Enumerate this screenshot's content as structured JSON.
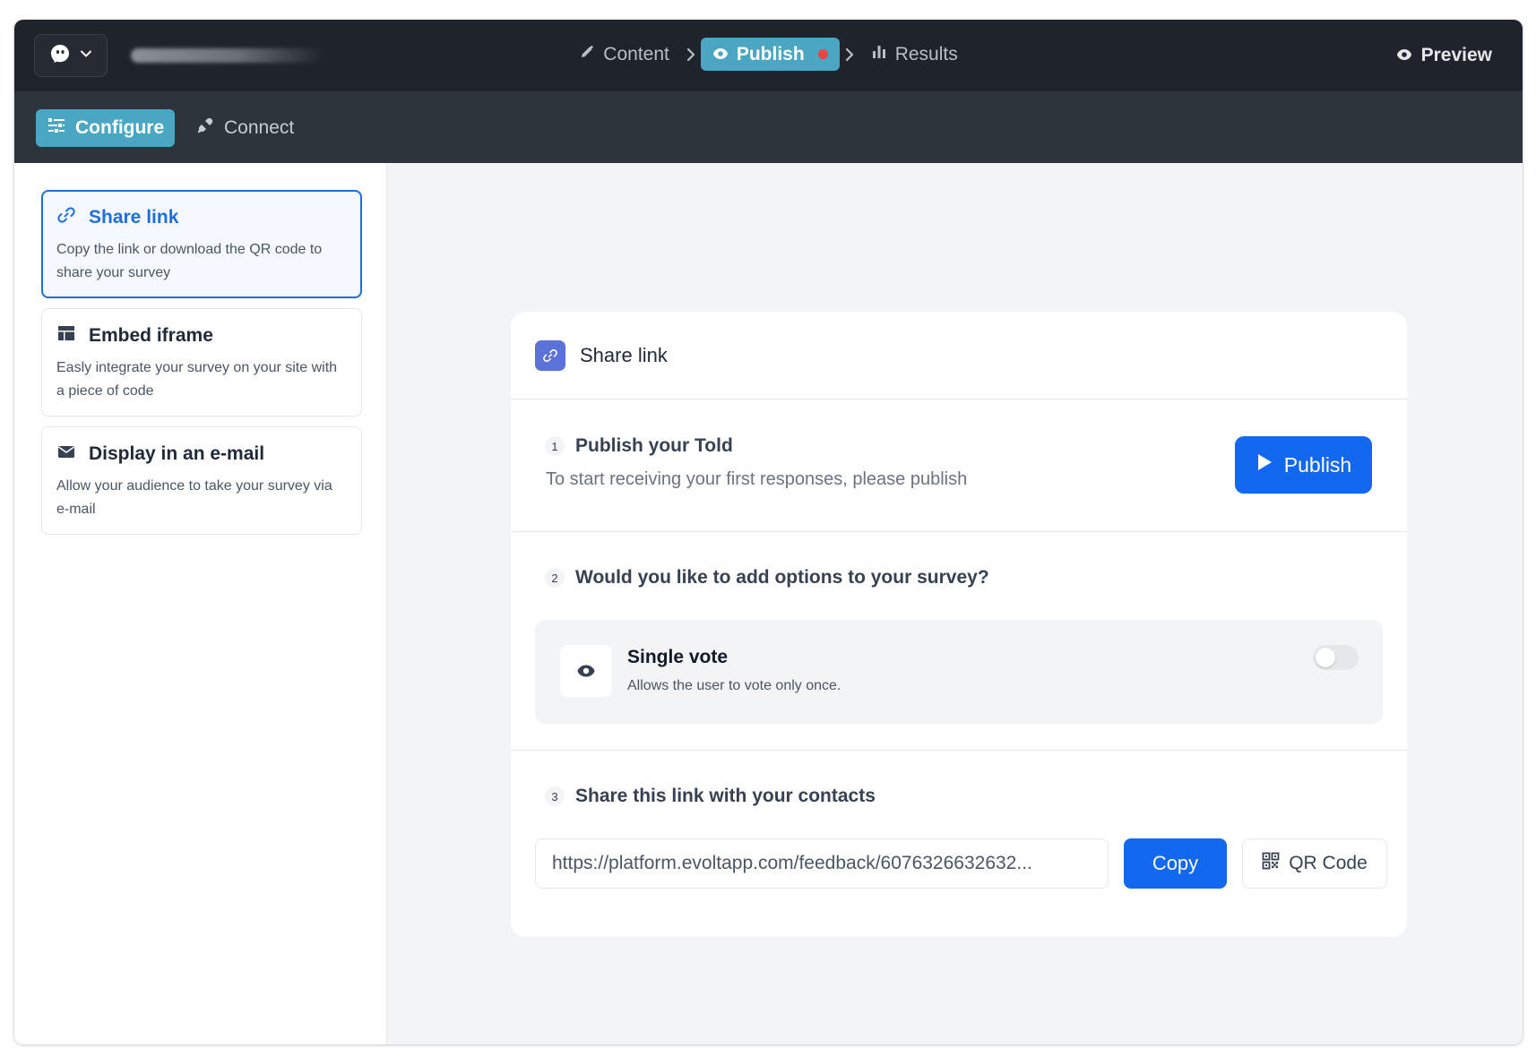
{
  "nav": {
    "steps": [
      {
        "label": "Content",
        "icon": "pencil-icon"
      },
      {
        "label": "Publish",
        "icon": "eye-icon",
        "active": true
      },
      {
        "label": "Results",
        "icon": "bar-chart-icon"
      }
    ],
    "preview_label": "Preview"
  },
  "subnav": {
    "configure_label": "Configure",
    "connect_label": "Connect"
  },
  "sidebar": {
    "items": [
      {
        "title": "Share link",
        "desc": "Copy the link or download the QR code to share your survey",
        "icon": "link-icon",
        "selected": true
      },
      {
        "title": "Embed iframe",
        "desc": "Easly integrate your survey on your site with a piece of code",
        "icon": "layout-icon"
      },
      {
        "title": "Display in an e-mail",
        "desc": "Allow your audience to take your survey via e-mail",
        "icon": "envelope-icon"
      }
    ]
  },
  "panel": {
    "title": "Share link",
    "step1": {
      "number": "1",
      "title": "Publish your Told",
      "desc": "To start receiving your first responses, please publish",
      "button_label": "Publish"
    },
    "step2": {
      "number": "2",
      "title": "Would you like to add options to your survey?",
      "option_title": "Single vote",
      "option_desc": "Allows the user to vote only once.",
      "toggle_on": false
    },
    "step3": {
      "number": "3",
      "title": "Share this link with your contacts",
      "url": "https://platform.evoltapp.com/feedback/6076326632632...",
      "copy_label": "Copy",
      "qr_label": "QR Code"
    }
  },
  "colors": {
    "accent": "#4aa6c2",
    "primary": "#1268ee",
    "selected_border": "#1d6fe0",
    "topbar": "#1f242c",
    "subbar": "#2e343c"
  }
}
